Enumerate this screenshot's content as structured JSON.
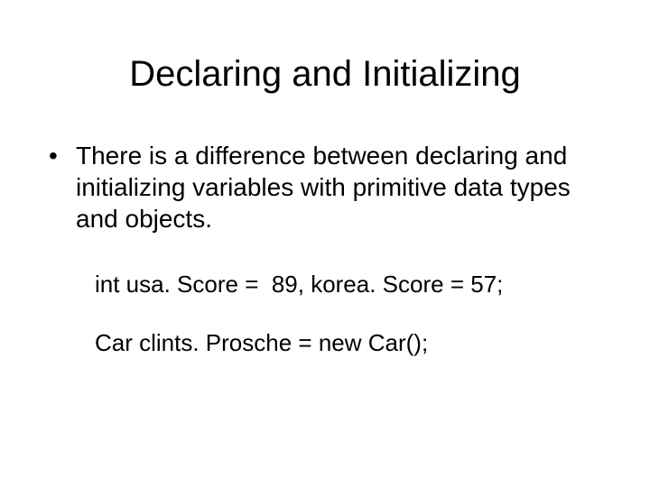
{
  "slide": {
    "title": "Declaring and Initializing",
    "bullets": [
      "There is a difference between declaring and initializing variables with primitive data types and objects."
    ],
    "code_lines": [
      "int usa. Score =  89, korea. Score = 57;",
      "Car clints. Prosche = new Car();"
    ]
  }
}
